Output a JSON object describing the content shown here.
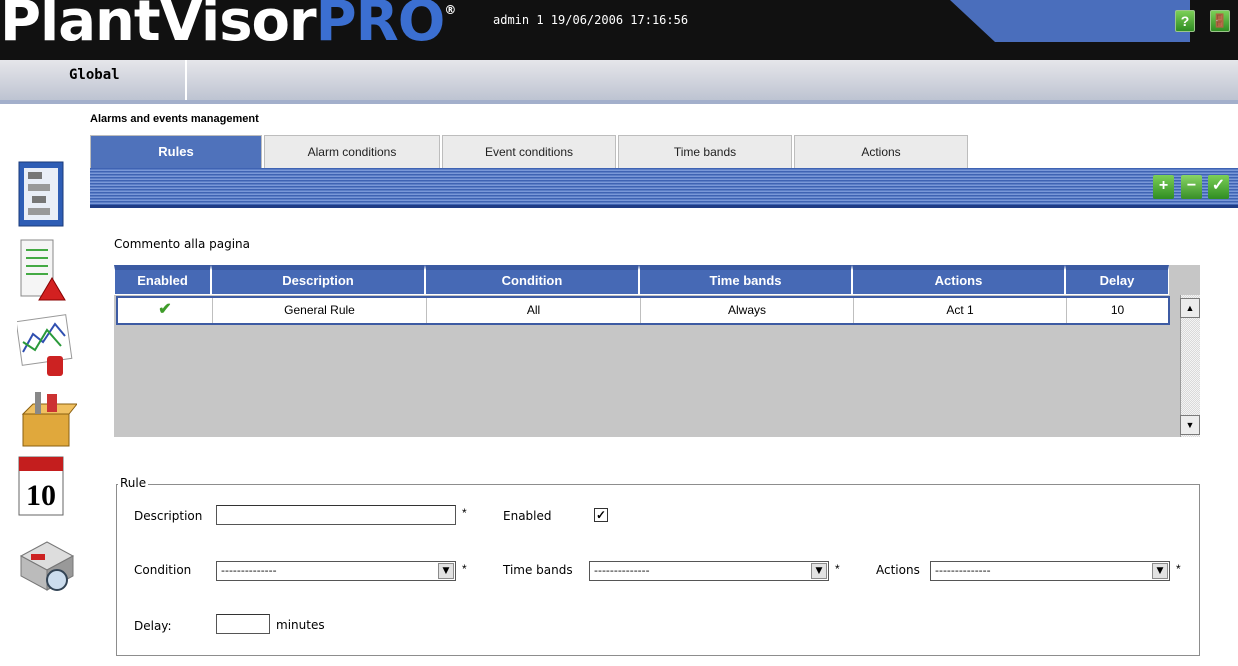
{
  "header": {
    "logo_main": "PlantVisor",
    "logo_accent": "PRO",
    "logo_reg": "®",
    "session_info": "admin 1 19/06/2006 17:16:56",
    "help_label": "?",
    "exit_label": "🚪"
  },
  "nav": {
    "global_label": "Global"
  },
  "sidebar_icons": [
    "site-map-icon",
    "alarm-report-icon",
    "graph-report-icon",
    "tools-box-icon",
    "calendar-icon",
    "device-plant-icon"
  ],
  "page": {
    "title": "Alarms and events management",
    "comment": "Commento alla pagina"
  },
  "tabs": [
    {
      "label": "Rules",
      "active": true
    },
    {
      "label": "Alarm conditions"
    },
    {
      "label": "Event conditions"
    },
    {
      "label": "Time bands"
    },
    {
      "label": "Actions"
    }
  ],
  "toolbar": {
    "add_label": "+",
    "remove_label": "−",
    "confirm_label": "✓"
  },
  "table": {
    "columns": [
      "Enabled",
      "Description",
      "Condition",
      "Time bands",
      "Actions",
      "Delay"
    ],
    "rows": [
      {
        "enabled": "✔",
        "description": "General Rule",
        "condition": "All",
        "time_bands": "Always",
        "actions": "Act 1",
        "delay": "10"
      }
    ],
    "scroll_up": "▲",
    "scroll_down": "▼"
  },
  "form": {
    "legend": "Rule",
    "description_label": "Description",
    "description_value": "",
    "required_mark": "*",
    "enabled_label": "Enabled",
    "enabled_checked": "✓",
    "condition_label": "Condition",
    "condition_value": "--------------",
    "time_bands_label": "Time bands",
    "time_bands_value": "--------------",
    "actions_label": "Actions",
    "actions_value": "--------------",
    "delay_label": "Delay:",
    "delay_value": "",
    "delay_unit": "minutes",
    "dropdown_arrow": "▼"
  },
  "colors": {
    "accent_blue": "#4669b5",
    "toolbar_green": "#2f8d22"
  }
}
